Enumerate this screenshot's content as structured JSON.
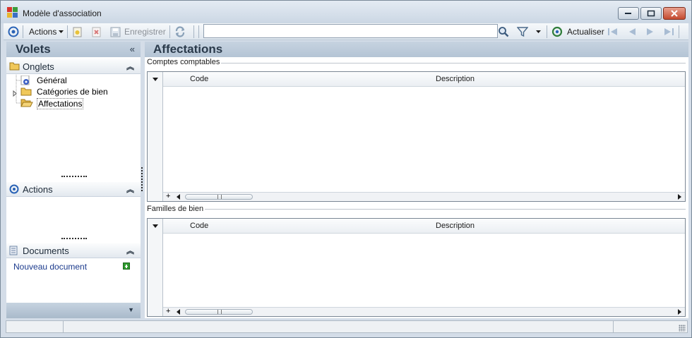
{
  "window": {
    "title": "Modèle d'association"
  },
  "toolbar": {
    "actions_label": "Actions",
    "save_label": "Enregistrer",
    "search_value": "",
    "refresh_label": "Actualiser"
  },
  "left_panel": {
    "title": "Volets",
    "tabs_section": {
      "label": "Onglets",
      "items": [
        {
          "label": "Général",
          "icon": "general-icon"
        },
        {
          "label": "Catégories de bien",
          "icon": "folder-icon"
        },
        {
          "label": "Affectations",
          "icon": "folder-open-icon"
        }
      ]
    },
    "actions_section": {
      "label": "Actions"
    },
    "documents_section": {
      "label": "Documents",
      "new_link": "Nouveau document"
    }
  },
  "main": {
    "title": "Affectations",
    "groups": [
      {
        "label": "Comptes comptables",
        "columns": [
          "Code",
          "Description"
        ],
        "footer_plus": "+"
      },
      {
        "label": "Familles de bien",
        "columns": [
          "Code",
          "Description"
        ],
        "footer_plus": "+"
      }
    ]
  },
  "colors": {
    "panel_header": "#b4c4d5",
    "header_text": "#2a3a4b",
    "link": "#1b3a8c",
    "close_button": "#c44a2f"
  }
}
